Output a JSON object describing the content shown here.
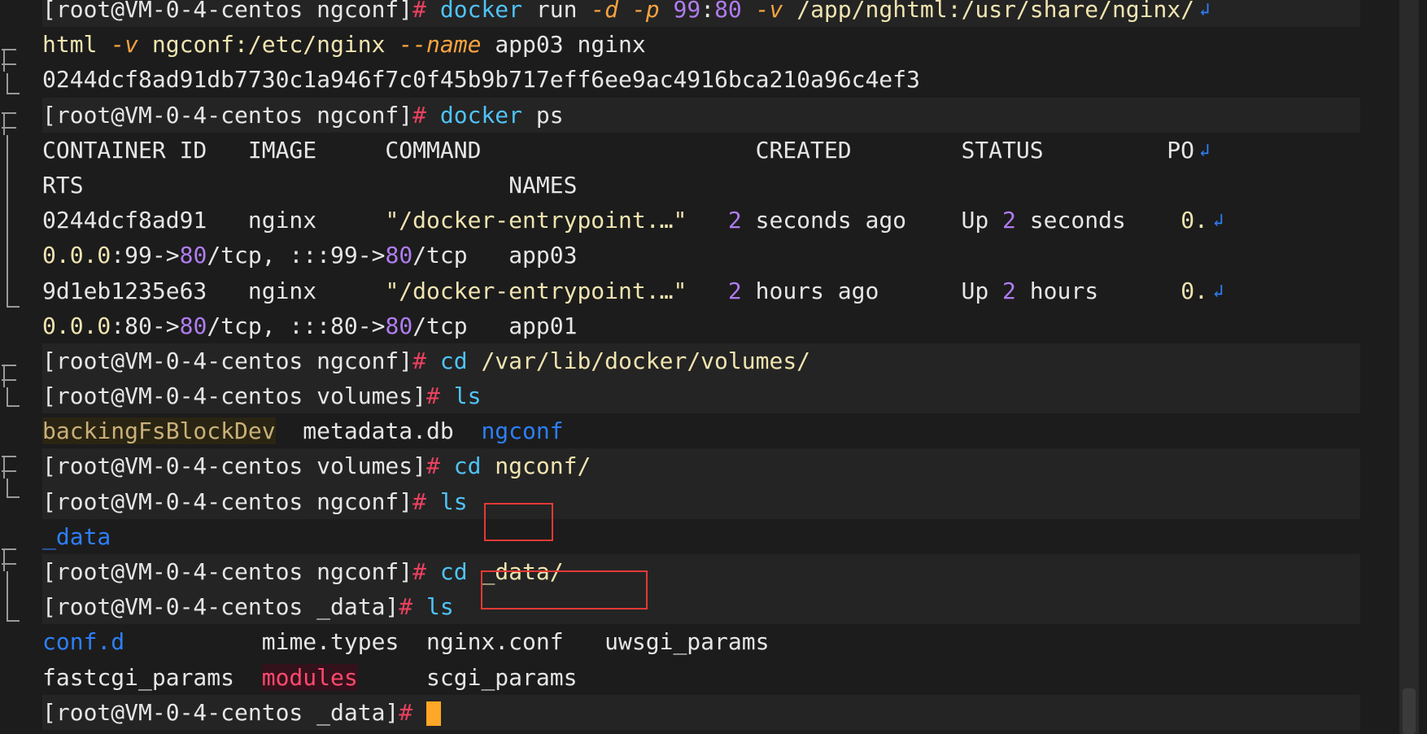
{
  "terminal": {
    "lines": [
      {
        "segments": [
          {
            "t": "[root@VM-0-4-centos ngconf]",
            "c": "prompt"
          },
          {
            "t": "# ",
            "c": "hash"
          },
          {
            "t": "docker",
            "c": "cmd"
          },
          {
            "t": " run ",
            "c": "name"
          },
          {
            "t": "-d",
            "c": "flag"
          },
          {
            "t": " ",
            "c": "name"
          },
          {
            "t": "-p",
            "c": "flag"
          },
          {
            "t": " ",
            "c": "name"
          },
          {
            "t": "99",
            "c": "num"
          },
          {
            "t": ":",
            "c": "name"
          },
          {
            "t": "80",
            "c": "num"
          },
          {
            "t": " ",
            "c": "name"
          },
          {
            "t": "-v",
            "c": "flag"
          },
          {
            "t": " /app/nghtml:/usr/share/nginx/",
            "c": "path"
          }
        ],
        "wrap": true
      },
      {
        "segments": [
          {
            "t": "html ",
            "c": "path"
          },
          {
            "t": "-v",
            "c": "flag"
          },
          {
            "t": " ngconf:/etc/nginx ",
            "c": "path"
          },
          {
            "t": "--name",
            "c": "flag"
          },
          {
            "t": " app03 nginx",
            "c": "name"
          }
        ]
      },
      {
        "segments": [
          {
            "t": "0244dcf8ad91db7730c1a946f7c0f45b9b717eff6ee9ac4916bca210a96c4ef3",
            "c": "name"
          }
        ]
      },
      {
        "segments": [
          {
            "t": "[root@VM-0-4-centos ngconf]",
            "c": "prompt"
          },
          {
            "t": "# ",
            "c": "hash"
          },
          {
            "t": "docker",
            "c": "cmd"
          },
          {
            "t": " ps",
            "c": "name"
          }
        ]
      },
      {
        "segments": [
          {
            "t": "CONTAINER ID   IMAGE     COMMAND                    CREATED        STATUS         PO",
            "c": "name"
          }
        ],
        "wrap": true
      },
      {
        "segments": [
          {
            "t": "RTS                               NAMES",
            "c": "name"
          }
        ]
      },
      {
        "segments": [
          {
            "t": "0244dcf8ad91   nginx     ",
            "c": "name"
          },
          {
            "t": "\"/docker-entrypoint.…\"",
            "c": "path"
          },
          {
            "t": "   ",
            "c": "name"
          },
          {
            "t": "2",
            "c": "num"
          },
          {
            "t": " seconds ago    Up ",
            "c": "name"
          },
          {
            "t": "2",
            "c": "num"
          },
          {
            "t": " seconds    ",
            "c": "name"
          },
          {
            "t": "0.",
            "c": "path"
          }
        ],
        "wrap": true
      },
      {
        "segments": [
          {
            "t": "0.0.0",
            "c": "path"
          },
          {
            "t": ":99->",
            "c": "name"
          },
          {
            "t": "80",
            "c": "num"
          },
          {
            "t": "/tcp, :::99->",
            "c": "name"
          },
          {
            "t": "80",
            "c": "num"
          },
          {
            "t": "/tcp   app03",
            "c": "name"
          }
        ]
      },
      {
        "segments": [
          {
            "t": "9d1eb1235e63   nginx     ",
            "c": "name"
          },
          {
            "t": "\"/docker-entrypoint.…\"",
            "c": "path"
          },
          {
            "t": "   ",
            "c": "name"
          },
          {
            "t": "2",
            "c": "num"
          },
          {
            "t": " hours ago      Up ",
            "c": "name"
          },
          {
            "t": "2",
            "c": "num"
          },
          {
            "t": " hours      ",
            "c": "name"
          },
          {
            "t": "0.",
            "c": "path"
          }
        ],
        "wrap": true
      },
      {
        "segments": [
          {
            "t": "0.0.0",
            "c": "path"
          },
          {
            "t": ":80->",
            "c": "name"
          },
          {
            "t": "80",
            "c": "num"
          },
          {
            "t": "/tcp, :::80->",
            "c": "name"
          },
          {
            "t": "80",
            "c": "num"
          },
          {
            "t": "/tcp   app01",
            "c": "name"
          }
        ]
      },
      {
        "segments": [
          {
            "t": "[root@VM-0-4-centos ngconf]",
            "c": "prompt"
          },
          {
            "t": "# ",
            "c": "hash"
          },
          {
            "t": "cd",
            "c": "cmd"
          },
          {
            "t": " /var/lib/docker/volumes/",
            "c": "path"
          }
        ]
      },
      {
        "segments": [
          {
            "t": "[root@VM-0-4-centos volumes]",
            "c": "prompt"
          },
          {
            "t": "# ",
            "c": "hash"
          },
          {
            "t": "ls",
            "c": "cmd"
          }
        ]
      },
      {
        "segments": [
          {
            "t": "backingFsBlockDev",
            "c": "highlight-yellow"
          },
          {
            "t": "  metadata.db  ",
            "c": "name"
          },
          {
            "t": "ngconf",
            "c": "dir"
          }
        ]
      },
      {
        "segments": [
          {
            "t": "[root@VM-0-4-centos volumes]",
            "c": "prompt"
          },
          {
            "t": "# ",
            "c": "hash"
          },
          {
            "t": "cd",
            "c": "cmd"
          },
          {
            "t": " ngconf/",
            "c": "path"
          }
        ]
      },
      {
        "segments": [
          {
            "t": "[root@VM-0-4-centos ngconf]",
            "c": "prompt"
          },
          {
            "t": "# ",
            "c": "hash"
          },
          {
            "t": "ls",
            "c": "cmd"
          }
        ]
      },
      {
        "segments": [
          {
            "t": "_data",
            "c": "dir"
          }
        ]
      },
      {
        "segments": [
          {
            "t": "[root@VM-0-4-centos ngconf]",
            "c": "prompt"
          },
          {
            "t": "# ",
            "c": "hash"
          },
          {
            "t": "cd",
            "c": "cmd"
          },
          {
            "t": " _data/",
            "c": "path"
          }
        ]
      },
      {
        "segments": [
          {
            "t": "[root@VM-0-4-centos _data]",
            "c": "prompt"
          },
          {
            "t": "# ",
            "c": "hash"
          },
          {
            "t": "ls",
            "c": "cmd"
          }
        ]
      },
      {
        "segments": [
          {
            "t": "conf.d",
            "c": "dir"
          },
          {
            "t": "          mime.types  nginx.conf   uwsgi_params",
            "c": "name"
          }
        ]
      },
      {
        "segments": [
          {
            "t": "fastcgi_params  ",
            "c": "name"
          },
          {
            "t": "modules",
            "c": "highlight-red"
          },
          {
            "t": "     scgi_params",
            "c": "name"
          }
        ]
      },
      {
        "segments": [
          {
            "t": "[root@VM-0-4-centos _data]",
            "c": "prompt"
          },
          {
            "t": "# ",
            "c": "hash"
          }
        ],
        "cursor": true
      }
    ]
  }
}
